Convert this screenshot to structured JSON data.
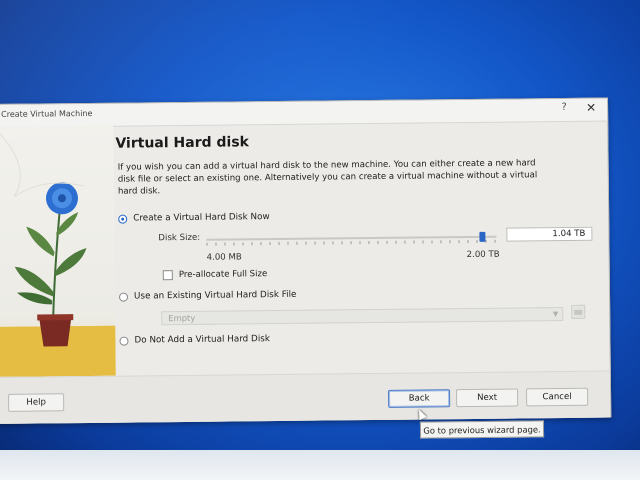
{
  "window": {
    "title": "Create Virtual Machine",
    "help_symbol": "?",
    "close_symbol": "✕"
  },
  "page": {
    "heading": "Virtual Hard disk",
    "description": "If you wish you can add a virtual hard disk to the new machine. You can either create a new hard disk file or select an existing one. Alternatively you can create a virtual machine without a virtual hard disk."
  },
  "options": {
    "create_new": {
      "label": "Create a Virtual Hard Disk Now",
      "selected": true
    },
    "use_existing": {
      "label": "Use an Existing Virtual Hard Disk File",
      "selected": false
    },
    "no_disk": {
      "label": "Do Not Add a Virtual Hard Disk",
      "selected": false
    }
  },
  "disk_size": {
    "label": "Disk Size:",
    "value": "1.04 TB",
    "min_label": "4.00 MB",
    "max_label": "2.00 TB",
    "slider_fraction": 0.96
  },
  "preallocate": {
    "label": "Pre-allocate Full Size",
    "checked": false
  },
  "existing_file": {
    "value": "Empty",
    "enabled": false
  },
  "buttons": {
    "help": "Help",
    "back": "Back",
    "next": "Next",
    "cancel": "Cancel"
  },
  "tooltip": "Go to previous wizard page.",
  "colors": {
    "accent": "#2a67c4",
    "dialog_bg": "#ecebe7",
    "desktop_blue": "#1357c9"
  }
}
